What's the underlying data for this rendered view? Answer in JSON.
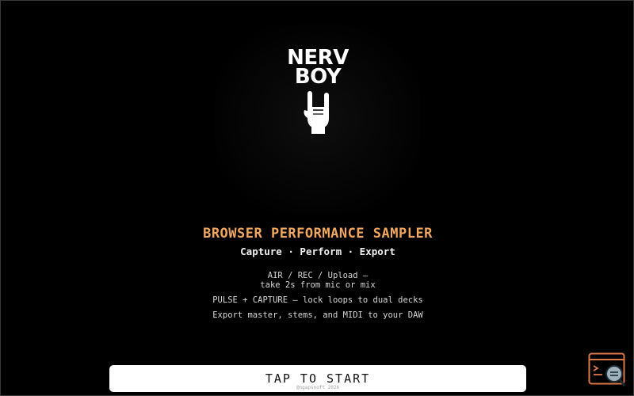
{
  "logo": {
    "line1": "NERV",
    "line2": "BOY",
    "icon": "rock-hand-icon"
  },
  "intro": {
    "title": "BROWSER PERFORMANCE SAMPLER",
    "subtitle": "Capture · Perform · Export"
  },
  "features": [
    {
      "line1": "AIR / REC / Upload —",
      "line2": "take 2s from mic or mix"
    },
    {
      "line1": "PULSE + CAPTURE — lock loops to dual decks"
    },
    {
      "line1": "Export master, stems, and MIDI to your DAW"
    }
  ],
  "start": {
    "label": "TAP TO START",
    "credit": "@ngapsnoft 2026"
  },
  "console": {
    "icon": "console-magnifier-icon"
  },
  "colors": {
    "background": "#000000",
    "accent": "#f0a860",
    "text": "#e8e8e8",
    "button": "#ffffff",
    "console_icon": "#d9784a"
  }
}
